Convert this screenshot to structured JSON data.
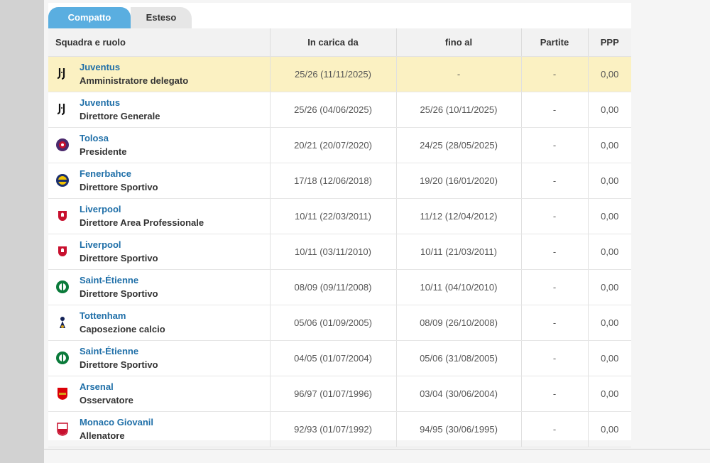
{
  "tabs": {
    "compact": "Compatto",
    "extended": "Esteso"
  },
  "headers": {
    "team_role": "Squadra e ruolo",
    "appointed": "In carica da",
    "until": "fino al",
    "matches": "Partite",
    "ppg": "PPP"
  },
  "rows": [
    {
      "team": "Juventus",
      "role": "Amministratore delegato",
      "from": "25/26 (11/11/2025)",
      "until": "-",
      "matches": "-",
      "ppg": "0,00",
      "crest": "juventus-crest-icon"
    },
    {
      "team": "Juventus",
      "role": "Direttore Generale",
      "from": "25/26 (04/06/2025)",
      "until": "25/26 (10/11/2025)",
      "matches": "-",
      "ppg": "0,00",
      "crest": "juventus-crest-icon"
    },
    {
      "team": "Tolosa",
      "role": "Presidente",
      "from": "20/21 (20/07/2020)",
      "until": "24/25 (28/05/2025)",
      "matches": "-",
      "ppg": "0,00",
      "crest": "toulouse-crest-icon"
    },
    {
      "team": "Fenerbahce",
      "role": "Direttore Sportivo",
      "from": "17/18 (12/06/2018)",
      "until": "19/20 (16/01/2020)",
      "matches": "-",
      "ppg": "0,00",
      "crest": "fenerbahce-crest-icon"
    },
    {
      "team": "Liverpool",
      "role": "Direttore Area Professionale",
      "from": "10/11 (22/03/2011)",
      "until": "11/12 (12/04/2012)",
      "matches": "-",
      "ppg": "0,00",
      "crest": "liverpool-crest-icon"
    },
    {
      "team": "Liverpool",
      "role": "Direttore Sportivo",
      "from": "10/11 (03/11/2010)",
      "until": "10/11 (21/03/2011)",
      "matches": "-",
      "ppg": "0,00",
      "crest": "liverpool-crest-icon"
    },
    {
      "team": "Saint-Étienne",
      "role": "Direttore Sportivo",
      "from": "08/09 (09/11/2008)",
      "until": "10/11 (04/10/2010)",
      "matches": "-",
      "ppg": "0,00",
      "crest": "saint-etienne-crest-icon"
    },
    {
      "team": "Tottenham",
      "role": "Caposezione calcio",
      "from": "05/06 (01/09/2005)",
      "until": "08/09 (26/10/2008)",
      "matches": "-",
      "ppg": "0,00",
      "crest": "tottenham-crest-icon"
    },
    {
      "team": "Saint-Étienne",
      "role": "Direttore Sportivo",
      "from": "04/05 (01/07/2004)",
      "until": "05/06 (31/08/2005)",
      "matches": "-",
      "ppg": "0,00",
      "crest": "saint-etienne-crest-icon"
    },
    {
      "team": "Arsenal",
      "role": "Osservatore",
      "from": "96/97 (01/07/1996)",
      "until": "03/04 (30/06/2004)",
      "matches": "-",
      "ppg": "0,00",
      "crest": "arsenal-crest-icon"
    },
    {
      "team": "Monaco Giovanil",
      "role": "Allenatore",
      "from": "92/93 (01/07/1992)",
      "until": "94/95 (30/06/1995)",
      "matches": "-",
      "ppg": "0,00",
      "crest": "monaco-crest-icon"
    }
  ],
  "colors": {
    "tab_active": "#5aaee0",
    "link": "#1f6fa8",
    "highlight_row": "#fbf1c2"
  }
}
